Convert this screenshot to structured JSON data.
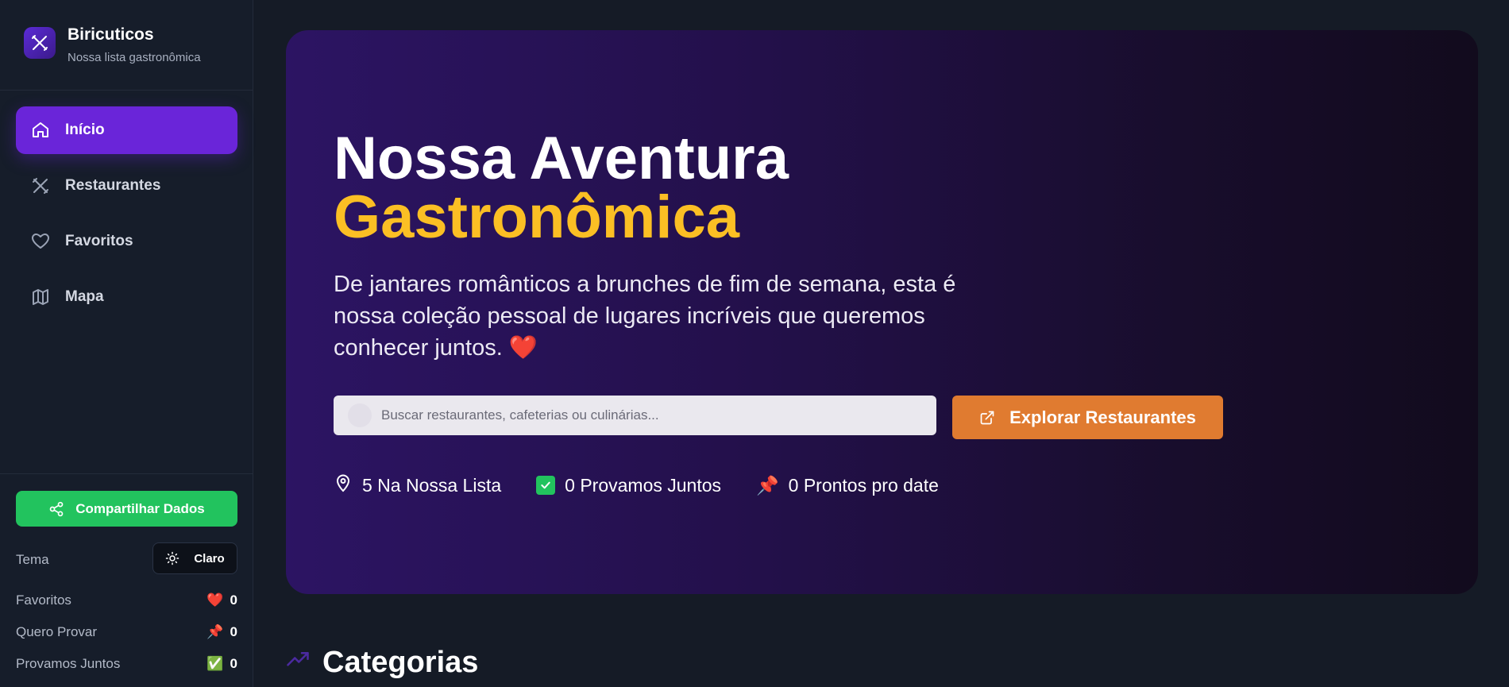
{
  "brand": {
    "title": "Biricuticos",
    "subtitle": "Nossa lista gastronômica",
    "logo_icon": "utensils-cross-icon"
  },
  "nav": [
    {
      "label": "Início",
      "icon": "home-icon",
      "active": true
    },
    {
      "label": "Restaurantes",
      "icon": "utensils-icon",
      "active": false
    },
    {
      "label": "Favoritos",
      "icon": "heart-icon",
      "active": false
    },
    {
      "label": "Mapa",
      "icon": "map-icon",
      "active": false
    }
  ],
  "sidebar_bottom": {
    "share_label": "Compartilhar Dados",
    "theme_label": "Tema",
    "theme_button": "Claro",
    "stats": [
      {
        "label": "Favoritos",
        "icon": "heart-emoji",
        "value": "0"
      },
      {
        "label": "Quero Provar",
        "icon": "pushpin-emoji",
        "value": "0"
      },
      {
        "label": "Provamos Juntos",
        "icon": "check-emoji",
        "value": "0"
      }
    ]
  },
  "hero": {
    "title_line1": "Nossa Aventura",
    "title_line2": "Gastronômica",
    "description": "De jantares românticos a brunches de fim de semana, esta é nossa coleção pessoal de lugares incríveis que queremos conhecer juntos. ❤️",
    "search_placeholder": "Buscar restaurantes, cafeterias ou culinárias...",
    "explore_label": "Explorar Restaurantes",
    "stats": [
      {
        "text": "5 Na Nossa Lista",
        "icon": "map-pin-icon"
      },
      {
        "text": "0 Provamos Juntos",
        "icon": "check-icon"
      },
      {
        "text": "0 Prontos pro date",
        "icon": "pushpin-icon"
      }
    ]
  },
  "categories": {
    "title": "Categorias",
    "icon": "trending-up-icon"
  },
  "colors": {
    "accent_purple": "#6a25d9",
    "accent_yellow": "#fbbf24",
    "accent_orange": "#e07b30",
    "accent_green": "#22c35e",
    "background": "#151b26"
  }
}
